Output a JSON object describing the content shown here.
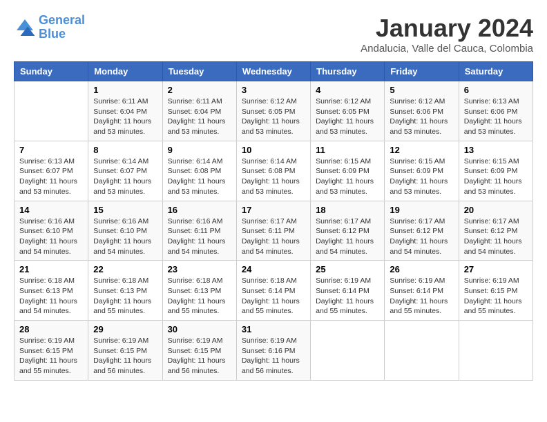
{
  "logo": {
    "line1": "General",
    "line2": "Blue"
  },
  "title": "January 2024",
  "subtitle": "Andalucia, Valle del Cauca, Colombia",
  "days_of_week": [
    "Sunday",
    "Monday",
    "Tuesday",
    "Wednesday",
    "Thursday",
    "Friday",
    "Saturday"
  ],
  "weeks": [
    [
      {
        "day": "",
        "info": ""
      },
      {
        "day": "1",
        "info": "Sunrise: 6:11 AM\nSunset: 6:04 PM\nDaylight: 11 hours\nand 53 minutes."
      },
      {
        "day": "2",
        "info": "Sunrise: 6:11 AM\nSunset: 6:04 PM\nDaylight: 11 hours\nand 53 minutes."
      },
      {
        "day": "3",
        "info": "Sunrise: 6:12 AM\nSunset: 6:05 PM\nDaylight: 11 hours\nand 53 minutes."
      },
      {
        "day": "4",
        "info": "Sunrise: 6:12 AM\nSunset: 6:05 PM\nDaylight: 11 hours\nand 53 minutes."
      },
      {
        "day": "5",
        "info": "Sunrise: 6:12 AM\nSunset: 6:06 PM\nDaylight: 11 hours\nand 53 minutes."
      },
      {
        "day": "6",
        "info": "Sunrise: 6:13 AM\nSunset: 6:06 PM\nDaylight: 11 hours\nand 53 minutes."
      }
    ],
    [
      {
        "day": "7",
        "info": "Sunrise: 6:13 AM\nSunset: 6:07 PM\nDaylight: 11 hours\nand 53 minutes."
      },
      {
        "day": "8",
        "info": "Sunrise: 6:14 AM\nSunset: 6:07 PM\nDaylight: 11 hours\nand 53 minutes."
      },
      {
        "day": "9",
        "info": "Sunrise: 6:14 AM\nSunset: 6:08 PM\nDaylight: 11 hours\nand 53 minutes."
      },
      {
        "day": "10",
        "info": "Sunrise: 6:14 AM\nSunset: 6:08 PM\nDaylight: 11 hours\nand 53 minutes."
      },
      {
        "day": "11",
        "info": "Sunrise: 6:15 AM\nSunset: 6:09 PM\nDaylight: 11 hours\nand 53 minutes."
      },
      {
        "day": "12",
        "info": "Sunrise: 6:15 AM\nSunset: 6:09 PM\nDaylight: 11 hours\nand 53 minutes."
      },
      {
        "day": "13",
        "info": "Sunrise: 6:15 AM\nSunset: 6:09 PM\nDaylight: 11 hours\nand 53 minutes."
      }
    ],
    [
      {
        "day": "14",
        "info": "Sunrise: 6:16 AM\nSunset: 6:10 PM\nDaylight: 11 hours\nand 54 minutes."
      },
      {
        "day": "15",
        "info": "Sunrise: 6:16 AM\nSunset: 6:10 PM\nDaylight: 11 hours\nand 54 minutes."
      },
      {
        "day": "16",
        "info": "Sunrise: 6:16 AM\nSunset: 6:11 PM\nDaylight: 11 hours\nand 54 minutes."
      },
      {
        "day": "17",
        "info": "Sunrise: 6:17 AM\nSunset: 6:11 PM\nDaylight: 11 hours\nand 54 minutes."
      },
      {
        "day": "18",
        "info": "Sunrise: 6:17 AM\nSunset: 6:12 PM\nDaylight: 11 hours\nand 54 minutes."
      },
      {
        "day": "19",
        "info": "Sunrise: 6:17 AM\nSunset: 6:12 PM\nDaylight: 11 hours\nand 54 minutes."
      },
      {
        "day": "20",
        "info": "Sunrise: 6:17 AM\nSunset: 6:12 PM\nDaylight: 11 hours\nand 54 minutes."
      }
    ],
    [
      {
        "day": "21",
        "info": "Sunrise: 6:18 AM\nSunset: 6:13 PM\nDaylight: 11 hours\nand 54 minutes."
      },
      {
        "day": "22",
        "info": "Sunrise: 6:18 AM\nSunset: 6:13 PM\nDaylight: 11 hours\nand 55 minutes."
      },
      {
        "day": "23",
        "info": "Sunrise: 6:18 AM\nSunset: 6:13 PM\nDaylight: 11 hours\nand 55 minutes."
      },
      {
        "day": "24",
        "info": "Sunrise: 6:18 AM\nSunset: 6:14 PM\nDaylight: 11 hours\nand 55 minutes."
      },
      {
        "day": "25",
        "info": "Sunrise: 6:19 AM\nSunset: 6:14 PM\nDaylight: 11 hours\nand 55 minutes."
      },
      {
        "day": "26",
        "info": "Sunrise: 6:19 AM\nSunset: 6:14 PM\nDaylight: 11 hours\nand 55 minutes."
      },
      {
        "day": "27",
        "info": "Sunrise: 6:19 AM\nSunset: 6:15 PM\nDaylight: 11 hours\nand 55 minutes."
      }
    ],
    [
      {
        "day": "28",
        "info": "Sunrise: 6:19 AM\nSunset: 6:15 PM\nDaylight: 11 hours\nand 55 minutes."
      },
      {
        "day": "29",
        "info": "Sunrise: 6:19 AM\nSunset: 6:15 PM\nDaylight: 11 hours\nand 56 minutes."
      },
      {
        "day": "30",
        "info": "Sunrise: 6:19 AM\nSunset: 6:15 PM\nDaylight: 11 hours\nand 56 minutes."
      },
      {
        "day": "31",
        "info": "Sunrise: 6:19 AM\nSunset: 6:16 PM\nDaylight: 11 hours\nand 56 minutes."
      },
      {
        "day": "",
        "info": ""
      },
      {
        "day": "",
        "info": ""
      },
      {
        "day": "",
        "info": ""
      }
    ]
  ]
}
